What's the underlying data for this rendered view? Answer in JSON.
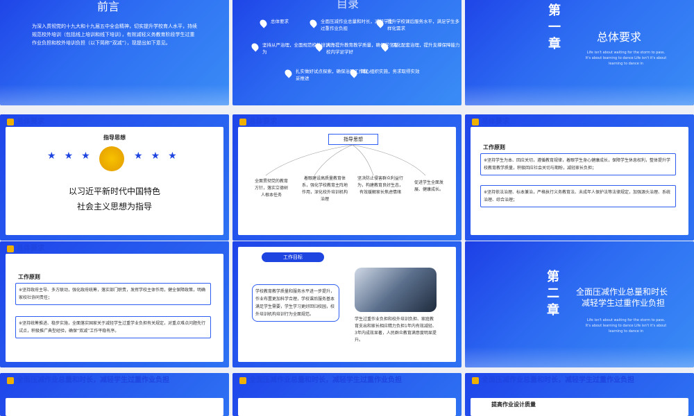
{
  "slide1": {
    "title": "前言",
    "body": "为深入贯彻党的十九大和十九届五中全会精神，切实提升学校育人水平，持续规范校外培训（包括线上培训和线下培训），有效减轻义务教育阶段学生过重作业负担和校外培训负担（以下简称“双减”），现提出如下意见。"
  },
  "slide2": {
    "title_fragment": "目录",
    "items": [
      "总体要求",
      "全面压减作业总量和时长，减轻学生过重作业负担",
      "提升学校课后服务水平，满足学生多样化需求",
      "坚持从严治理，全面规范校外培训行为",
      "大力提升教育教学质量，确保学生在校内学足学好",
      "强化配套治理，提升支撑保障能力",
      "扎实做好试点探索，确保治理工作稳妥推进",
      "精心组织实施，务求取得实效"
    ]
  },
  "slide3": {
    "chapter": "第一章",
    "title": "总体要求",
    "eng": "Life isn't about waiting for the storm to pass. It's about learning to dance Life isn't it's about learning to dance in"
  },
  "slide4": {
    "header": "总体要求",
    "subtitle": "指导思想",
    "line1": "以习近平新时代中国特色",
    "line2": "社会主义思想为指导",
    "star": "★"
  },
  "slide5": {
    "header": "总体要求",
    "box": "指导思想",
    "cols": [
      "全面贯彻党的教育方针，落实立德树人根本任务",
      "着眼建设高质量教育体系，强化学校教育主阵地作用，深化校外培训机构治理",
      "坚决防止侵害群众利益行为，构建教育良好生态，有效缓解家长焦虑情绪",
      "促进学生全面发展、健康成长。"
    ]
  },
  "slide6": {
    "header": "总体要求",
    "subtitle": "工作原则",
    "p1": "※坚持学生为本、回应关切，遵循教育规律，着眼学生身心健康成长，保障学生休息权利，整体提升学校教育教学质量，积极回应社会关切与期盼，减轻家长负担；",
    "p2": "※坚持依法治理、标本兼治，严格执行义务教育法、未成年人保护法等法律规定，加强源头治理、系统治理、综合治理；"
  },
  "slide7": {
    "header": "总体要求",
    "subtitle": "工作原则",
    "p1": "※坚持政府主导、多方联动，强化政府统筹，落实部门职责，发挥学校主体作用，健全保障政策，明确家校社协同责任；",
    "p2": "※坚持统筹推进、稳步实施，全面落实国家关于减轻学生过重学业负担有关规定，对重点难点问题先行试点，积极推广典型经验，确保“双减”工作平稳有序。"
  },
  "slide8": {
    "badge": "工作目标",
    "left": "学校教育教学质量和服务水平进一步提升，作业布置更加科学合理，学校课后服务基本满足学生需要，学生学习更好回归校园，校外培训机构培训行为全面规范。",
    "right": "学生过重作业负担和校外培训负担、家庭教育支出和家长相应精力负担1年内有效减轻、3年内成效显著，人民群众教育满意度明显提升。"
  },
  "slide9": {
    "chapter": "第二章",
    "title_line1": "全面压减作业总量和时长",
    "title_line2": "减轻学生过重作业负担",
    "eng": "Life isn't about waiting for the storm to pass. It's about learning to dance Life isn't it's about learning to dance in"
  },
  "slide10": {
    "header": "全面压减作业总量和时长，减轻学生过重作业负担"
  },
  "slide11": {
    "header": "全面压减作业总量和时长，减轻学生过重作业负担"
  },
  "slide12": {
    "header": "全面压减作业总量和时长，减轻学生过重作业负担",
    "subtitle": "提高作业设计质量"
  }
}
